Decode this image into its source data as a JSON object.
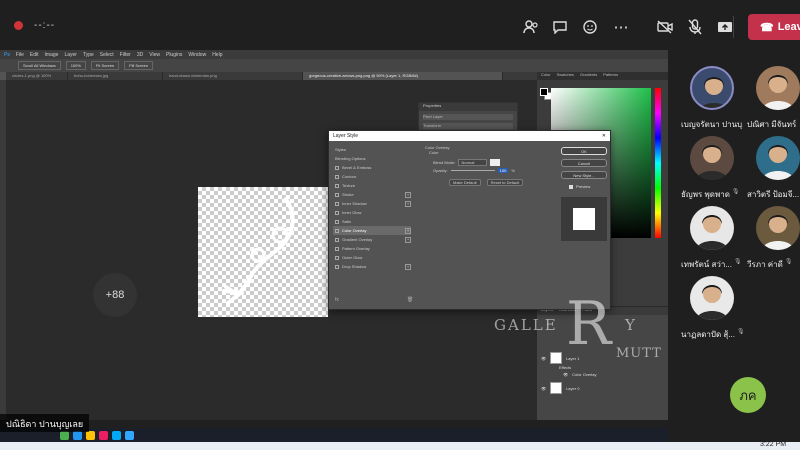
{
  "meeting": {
    "timer": "--:--",
    "leave_label": "Leave",
    "colors": {
      "leave": "#c4314b",
      "recording": "#d13438",
      "bar": "#1f1f1f"
    },
    "buttons": [
      "people-icon",
      "chat-icon",
      "more-icon",
      "camera-off-icon",
      "mic-off-icon",
      "share-icon"
    ]
  },
  "photoshop": {
    "menu": [
      "File",
      "Edit",
      "Image",
      "Layer",
      "Type",
      "Select",
      "Filter",
      "3D",
      "View",
      "Plugins",
      "Window",
      "Help"
    ],
    "options": [
      "Scroll All Windows",
      "100%",
      "Fit Screen",
      "Fill Screen"
    ],
    "tabs": [
      "circles-1.png @ 100%",
      "boho-bohemian.jpg",
      "hand-drawn-bohemian.png",
      "gorgeous-creative-arrows-png.png @ 50% (Layer 1, RGB/8#)"
    ],
    "properties": {
      "title": "Properties",
      "layer": "Pixel Layer",
      "transform": "Transform",
      "w": "W 1231 px",
      "h": "H 7216 px"
    },
    "color_tabs": [
      "Color",
      "Swatches",
      "Gradients",
      "Patterns"
    ],
    "layers_tabs": [
      "Layers",
      "Channels",
      "Paths"
    ],
    "layers": [
      {
        "name": "Layer 1",
        "sub": [
          "Effects",
          "Color Overlay"
        ]
      },
      {
        "name": "Layer 0",
        "sub": []
      }
    ],
    "status": "66.67%"
  },
  "layer_style": {
    "title": "Layer Style",
    "items": [
      {
        "label": "Styles",
        "check": false,
        "sel": false
      },
      {
        "label": "Blending Options",
        "check": false,
        "sel": false
      },
      {
        "label": "Bevel & Emboss",
        "check": true,
        "sel": false
      },
      {
        "label": "Contour",
        "check": true,
        "sel": false
      },
      {
        "label": "Texture",
        "check": true,
        "sel": false
      },
      {
        "label": "Stroke",
        "check": true,
        "sel": false,
        "plus": true
      },
      {
        "label": "Inner Shadow",
        "check": true,
        "sel": false,
        "plus": true
      },
      {
        "label": "Inner Glow",
        "check": true,
        "sel": false
      },
      {
        "label": "Satin",
        "check": true,
        "sel": false
      },
      {
        "label": "Color Overlay",
        "check": true,
        "sel": true,
        "plus": true
      },
      {
        "label": "Gradient Overlay",
        "check": true,
        "sel": false,
        "plus": true
      },
      {
        "label": "Pattern Overlay",
        "check": true,
        "sel": false
      },
      {
        "label": "Outer Glow",
        "check": true,
        "sel": false
      },
      {
        "label": "Drop Shadow",
        "check": true,
        "sel": false,
        "plus": true
      }
    ],
    "section_title": "Color Overlay",
    "section_sub": "Color",
    "blend_label": "Blend Mode:",
    "blend_value": "Normal",
    "opacity_label": "Opacity:",
    "opacity_value": "100",
    "make_default": "Make Default",
    "reset_default": "Reset to Default",
    "ok": "OK",
    "cancel": "Cancel",
    "new_style": "New Style...",
    "preview": "Preview"
  },
  "watermark": {
    "left": "GALLE",
    "center": "R",
    "right": "Y",
    "sub": "MUTT"
  },
  "presenter_tag": "ปณิธิดา ปานบุญเลย",
  "participants": [
    {
      "name": "เบญจรัตนา ปานบุ...",
      "speaking": true,
      "muted": false,
      "color": "#3a4b6e"
    },
    {
      "name": "ปณิศา มีจันทร์",
      "speaking": false,
      "muted": false,
      "color": "#a07a5c"
    },
    {
      "name": "ธัญพร พุดพาด",
      "speaking": false,
      "muted": true,
      "color": "#5c4a40"
    },
    {
      "name": "สาวิตรี ป้อมจี...",
      "speaking": false,
      "muted": true,
      "color": "#2e6e8a"
    },
    {
      "name": "เทพรัตน์ สว่า...",
      "speaking": false,
      "muted": true,
      "color": "#e7e7e7"
    },
    {
      "name": "วีรภา ค่าดี",
      "speaking": false,
      "muted": true,
      "color": "#6b5a3e"
    },
    {
      "name": "นาฏลดาปัด สุ้...",
      "speaking": false,
      "muted": true,
      "color": "#e9e9e9"
    }
  ],
  "more_count": "+88",
  "self_initials": "ภค",
  "clock": "3:22 PM"
}
